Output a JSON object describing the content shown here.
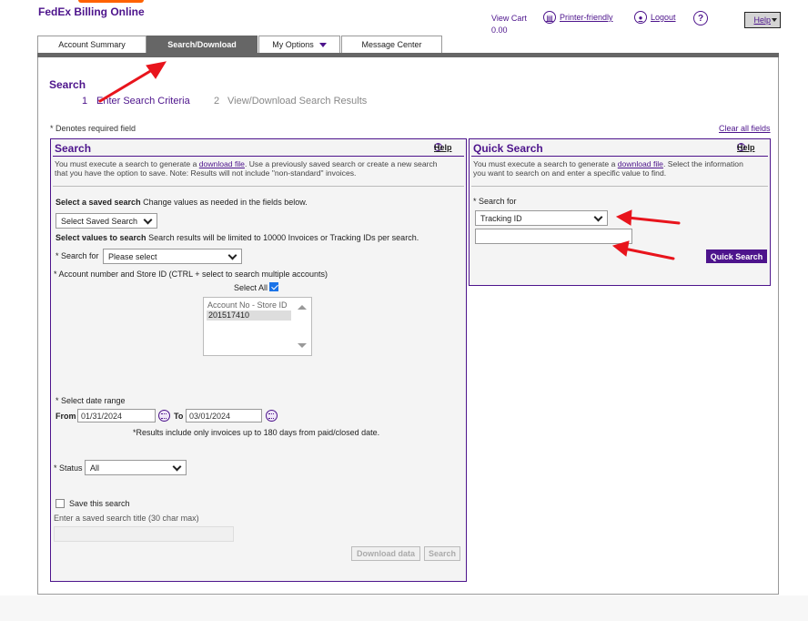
{
  "header": {
    "brand": "FedEx Billing Online",
    "view_cart_label": "View Cart",
    "view_cart_amount": "0.00",
    "printer_friendly": "Printer-friendly",
    "logout": "Logout",
    "help_icon": "?",
    "help_menu": "Help"
  },
  "tabs": [
    {
      "label": "Account Summary"
    },
    {
      "label": "Search/Download"
    },
    {
      "label": "My Options"
    },
    {
      "label": "Message Center"
    }
  ],
  "page": {
    "title": "Search",
    "steps": [
      {
        "num": "1",
        "label": "Enter Search Criteria"
      },
      {
        "num": "2",
        "label": "View/Download Search Results"
      }
    ],
    "required_note": "* Denotes required field",
    "clear_all": "Clear all fields"
  },
  "search_panel": {
    "title": "Search",
    "help": "Help",
    "desc_1": "You must execute a search to generate a ",
    "desc_link": "download file",
    "desc_2": ". Use a previously saved search or create a new search",
    "desc_3": "that you have the option to save. Note: Results will not include \"non-standard\" invoices.",
    "saved_search_bold": "Select a saved search",
    "saved_search_rest": " Change values as needed in the fields below.",
    "saved_search_value": "Select Saved Search",
    "values_bold": "Select values to search",
    "values_rest": " Search results will be limited to 10000 Invoices or Tracking IDs per search.",
    "search_for_label": "* Search for",
    "search_for_value": "Please select",
    "account_label": "* Account number and Store ID (CTRL + select to search multiple accounts)",
    "select_all": "Select All",
    "select_all_checked": true,
    "account_list_header": "Account No - Store ID",
    "account_list_items": [
      "201517410"
    ],
    "date_range_label": "* Select date range",
    "from_label": "From",
    "from_value": "01/31/2024",
    "to_label": "To",
    "to_value": "03/01/2024",
    "date_note": "*Results include only invoices up to 180 days from paid/closed date.",
    "status_label": "* Status",
    "status_value": "All",
    "save_search_label": "Save this search",
    "save_title_label": "Enter a saved search title (30 char max)",
    "save_title_value": "",
    "download_button": "Download data",
    "search_button": "Search"
  },
  "quick_search_panel": {
    "title": "Quick Search",
    "help": "Help",
    "desc_1": "You must execute a search to generate a ",
    "desc_link": "download file",
    "desc_2": ". Select the information",
    "desc_3": "you want to search on and enter a specific value to find.",
    "search_for_label": "* Search for",
    "search_for_value": "Tracking ID",
    "value_input": "",
    "button": "Quick Search"
  },
  "colors": {
    "brand_purple": "#4d148c",
    "tab_active": "#666666",
    "annotation_arrow": "#e8141c"
  }
}
